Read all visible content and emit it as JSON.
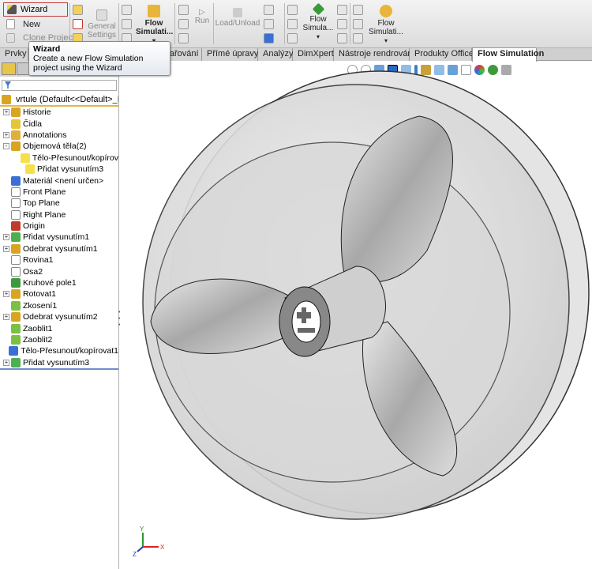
{
  "toolbar": {
    "wizard": "Wizard",
    "new": "New",
    "clone_project": "Clone Project",
    "general_settings": "General Settings",
    "flow_simulation_1": "Flow Simulati...",
    "run": "Run",
    "load_unload": "Load/Unload",
    "flow_simulation_2": "Flow Simula...",
    "flow_simulation_3": "Flow Simulati..."
  },
  "tabs": [
    "Prvky",
    "Svařování",
    "Přímé úpravy",
    "Analýzy",
    "DimXpert",
    "Nástroje rendrování",
    "Produkty Office",
    "Flow Simulation"
  ],
  "active_tab": "Flow Simulation",
  "tooltip": {
    "title": "Wizard",
    "text": "Create a new Flow Simulation project using the Wizard"
  },
  "tree": {
    "root": "vrtule  (Default<<Default>_Disp",
    "items": [
      {
        "label": "Historie",
        "expand": "+",
        "icon": "history-icon",
        "color": "#d9a520"
      },
      {
        "label": "Čidla",
        "expand": "",
        "icon": "sensor-icon",
        "color": "#e7c33a"
      },
      {
        "label": "Annotations",
        "expand": "+",
        "icon": "annotation-icon",
        "color": "#e0b13a"
      },
      {
        "label": "Objemová těla(2)",
        "expand": "-",
        "icon": "solid-bodies-folder-icon",
        "color": "#d9a520"
      },
      {
        "label": "Tělo-Přesunout/kopírov",
        "expand": "",
        "indent": true,
        "icon": "solid-body-icon",
        "color": "#f5e04a"
      },
      {
        "label": "Přidat vysunutím3",
        "expand": "",
        "indent": true,
        "icon": "solid-body-icon",
        "color": "#f5e04a"
      },
      {
        "label": "Materiál <není určen>",
        "expand": "",
        "icon": "material-icon",
        "color": "#3a6fd5"
      },
      {
        "label": "Front Plane",
        "expand": "",
        "icon": "plane-icon",
        "color": "#ffffff"
      },
      {
        "label": "Top Plane",
        "expand": "",
        "icon": "plane-icon",
        "color": "#ffffff"
      },
      {
        "label": "Right Plane",
        "expand": "",
        "icon": "plane-icon",
        "color": "#ffffff"
      },
      {
        "label": "Origin",
        "expand": "",
        "icon": "origin-icon",
        "color": "#c0392b"
      },
      {
        "label": "Přidat vysunutím1",
        "expand": "+",
        "icon": "extrude-icon",
        "color": "#4caf50"
      },
      {
        "label": "Odebrat vysunutím1",
        "expand": "+",
        "icon": "cut-extrude-icon",
        "color": "#d9a520"
      },
      {
        "label": "Rovina1",
        "expand": "",
        "icon": "plane-icon",
        "color": "#ffffff"
      },
      {
        "label": "Osa2",
        "expand": "",
        "icon": "axis-icon",
        "color": "#ffffff"
      },
      {
        "label": "Kruhové pole1",
        "expand": "",
        "icon": "circular-pattern-icon",
        "color": "#3c9a3c"
      },
      {
        "label": "Rotovat1",
        "expand": "+",
        "icon": "revolve-icon",
        "color": "#d9a520"
      },
      {
        "label": "Zkosení1",
        "expand": "",
        "icon": "chamfer-icon",
        "color": "#7bc043"
      },
      {
        "label": "Odebrat vysunutím2",
        "expand": "+",
        "icon": "cut-extrude-icon",
        "color": "#d9a520"
      },
      {
        "label": "Zaoblit1",
        "expand": "",
        "icon": "fillet-icon",
        "color": "#7bc043"
      },
      {
        "label": "Zaoblit2",
        "expand": "",
        "icon": "fillet-icon",
        "color": "#7bc043"
      },
      {
        "label": "Tělo-Přesunout/kopírovat1",
        "expand": "",
        "icon": "move-copy-body-icon",
        "color": "#3a6fd5"
      },
      {
        "label": "Přidat vysunutím3",
        "expand": "+",
        "icon": "extrude-icon",
        "color": "#4caf50"
      }
    ]
  },
  "triad": {
    "x": "X",
    "y": "Y",
    "z": "Z"
  }
}
